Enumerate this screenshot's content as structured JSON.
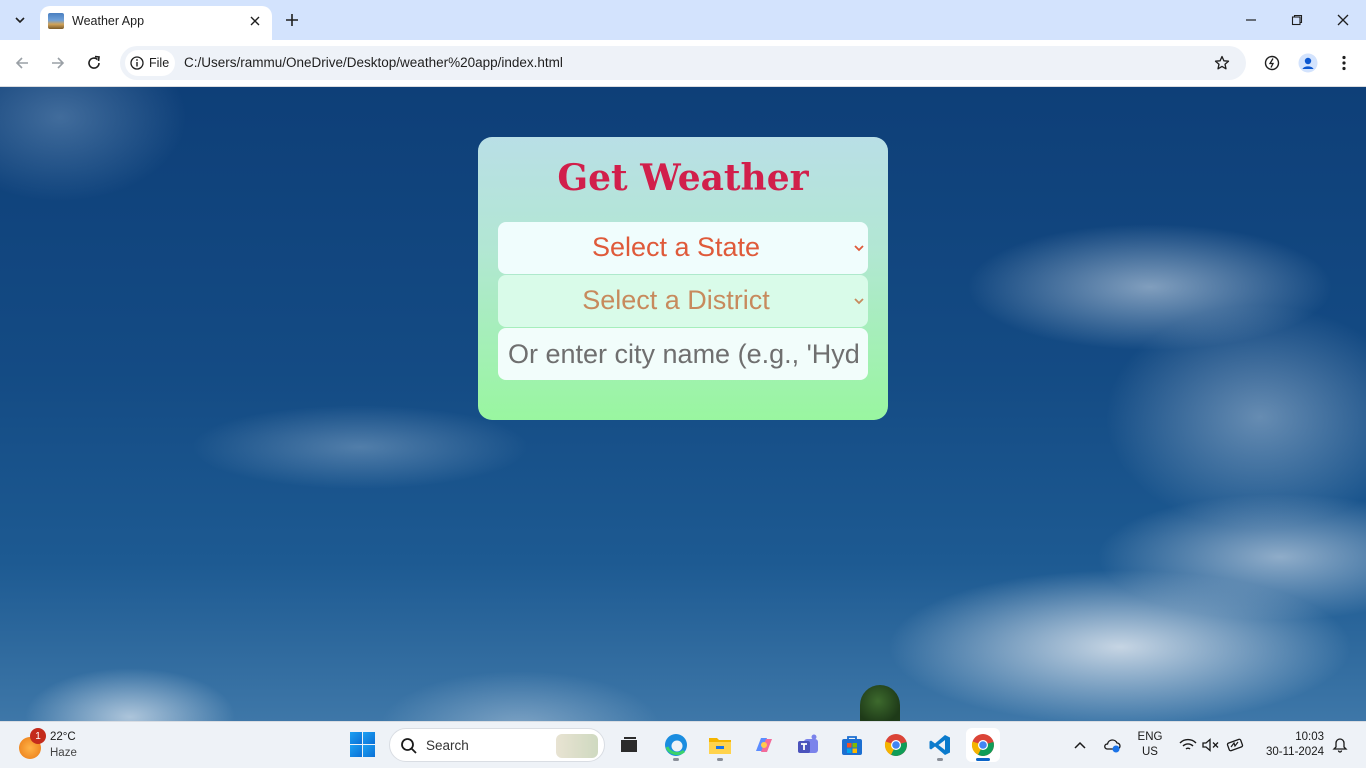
{
  "browser": {
    "tab_title": "Weather App",
    "site_chip_label": "File",
    "url": "C:/Users/rammu/OneDrive/Desktop/weather%20app/index.html"
  },
  "app": {
    "heading": "Get Weather",
    "state_select": {
      "selected": "Select a State"
    },
    "district_select": {
      "selected": "Select a District"
    },
    "city_input": {
      "placeholder": "Or enter city name (e.g., 'Hyderabad')",
      "value": ""
    }
  },
  "taskbar": {
    "weather": {
      "temperature": "22°C",
      "condition": "Haze",
      "badge_count": "1"
    },
    "search_label": "Search",
    "language": {
      "line1": "ENG",
      "line2": "US"
    },
    "clock": {
      "time": "10:03",
      "date": "30-11-2024"
    },
    "apps": [
      "task-view",
      "edge",
      "file-explorer",
      "copilot",
      "teams",
      "microsoft-store",
      "chrome",
      "vs-code",
      "chrome-active"
    ]
  },
  "colors": {
    "heading": "#d11f4b",
    "state_text": "#df5a3a",
    "district_text": "#c78a5d",
    "card_top": "#b9dfe6",
    "card_bottom": "#99f6a0"
  }
}
